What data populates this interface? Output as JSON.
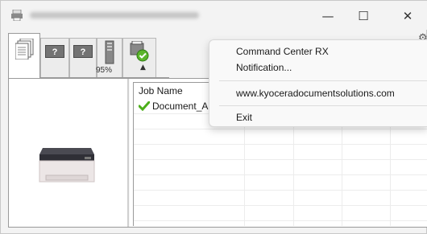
{
  "window": {
    "minimize_glyph": "—",
    "maximize_glyph": "☐",
    "close_glyph": "✕"
  },
  "toolbar": {
    "tabs": [
      {
        "icon": "document-stack-icon"
      },
      {
        "icon": "unknown-printer-icon",
        "glyph": "?"
      },
      {
        "icon": "unknown-printer-icon",
        "glyph": "?"
      },
      {
        "icon": "toner-cartridge-icon",
        "label": "95%",
        "level": 0.95
      },
      {
        "icon": "scan-status-icon"
      }
    ],
    "collapse_glyph": "▲"
  },
  "jobs": {
    "columns": [
      "Job Name"
    ],
    "rows": [
      {
        "name": "Document_AB",
        "status_icon": "check-icon"
      }
    ]
  },
  "context_menu": {
    "items": [
      {
        "label": "Command Center RX"
      },
      {
        "label": "Notification..."
      },
      {
        "label": "www.kyoceradocumentsolutions.com"
      },
      {
        "label": "Exit"
      }
    ]
  },
  "colors": {
    "check": "#4caf1a",
    "accent": "#2e7d32"
  }
}
